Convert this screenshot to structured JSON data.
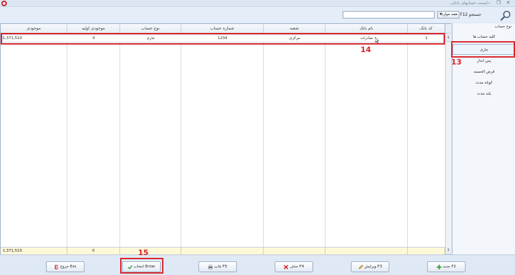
{
  "window": {
    "title": "لیست حسابهای بانکی"
  },
  "search": {
    "label": "جستجو F12",
    "scope": "همه موارد",
    "value": ""
  },
  "grid": {
    "columns": [
      "کد بانک",
      "نام بانک",
      "شعبه",
      "شماره حساب",
      "نوع حساب",
      "موجودی اولیه",
      "موجودی"
    ],
    "rows": [
      {
        "code": "1",
        "bank": "صادرات",
        "branch": "مرکزی",
        "account_no": "1234",
        "type": "جاری",
        "initial": "0",
        "balance": "1,371,510"
      }
    ],
    "row_number": "1",
    "footer_row_number": "1",
    "totals": {
      "initial": "0",
      "balance": "1,371,510"
    }
  },
  "sidebar": {
    "title": "نوع حساب",
    "items": [
      {
        "label": "کلیه حساب ها"
      },
      {
        "label": "جاری"
      },
      {
        "label": "پس انداز"
      },
      {
        "label": "قرض الحسنه"
      },
      {
        "label": "کوتاه مدت"
      },
      {
        "label": "بلند مدت"
      }
    ],
    "selected_index": 1
  },
  "toolbar": {
    "new": "جدید F2",
    "edit": "ویرایش F3",
    "delete": "حذف F4",
    "print": "چاپ F5",
    "select": "انتخاب Enter",
    "exit": "خروج Esc"
  },
  "annotations": {
    "a13": "13",
    "a14": "14",
    "a15": "15"
  },
  "colors": {
    "highlight": "#d9252b",
    "footer_bg": "#fdf8d8",
    "toolbar_bg": "#dfe9f5"
  }
}
